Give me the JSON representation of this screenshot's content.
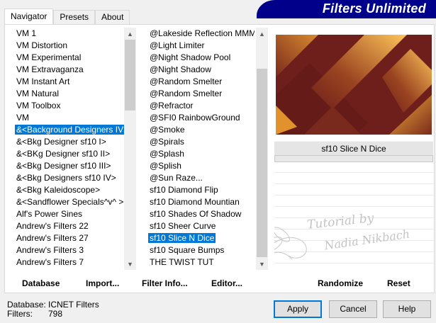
{
  "tabs": [
    {
      "label": "Navigator",
      "active": true
    },
    {
      "label": "Presets",
      "active": false
    },
    {
      "label": "About",
      "active": false
    }
  ],
  "banner": {
    "title": "Filters Unlimited",
    "color": "#00008b"
  },
  "categories": {
    "items": [
      "VM 1",
      "VM Distortion",
      "VM Experimental",
      "VM Extravaganza",
      "VM Instant Art",
      "VM Natural",
      "VM Toolbox",
      "VM",
      "&<Background Designers IV>",
      "&<Bkg Designer sf10 I>",
      "&<BKg Designer sf10 II>",
      "&<Bkg Designer sf10 III>",
      "&<Bkg Designers sf10 IV>",
      "&<Bkg Kaleidoscope>",
      "&<Sandflower Specials^v^ >",
      "Alf's Power Sines",
      "Andrew's Filters 22",
      "Andrew's Filters 27",
      "Andrew's Filters 3",
      "Andrew's Filters 7"
    ],
    "selected_index": 8
  },
  "filters": {
    "items": [
      "@Lakeside Reflection MMMM",
      "@Light Limiter",
      "@Night Shadow Pool",
      "@Night Shadow",
      "@Random Smelter",
      "@Random Smelter",
      "@Refractor",
      "@SFI0 RainbowGround",
      "@Smoke",
      "@Spirals",
      "@Splash",
      "@Splish",
      "@Sun Raze...",
      "sf10 Diamond Flip",
      "sf10 Diamond Mountian",
      "sf10 Shades Of Shadow",
      "sf10 Sheer Curve",
      "sf10 Slice N Dice",
      "sf10 Square Bumps",
      "THE TWIST TUT"
    ],
    "selected_index": 17
  },
  "preview": {
    "filter_name": "sf10 Slice N Dice",
    "colors": {
      "dark": "#6e1f1c",
      "light": "#f0a030"
    }
  },
  "watermark": {
    "line1": "Tutorial by",
    "line2": "Nadia Nikbach"
  },
  "toolbar": {
    "database": "Database",
    "import": "Import...",
    "filter_info": "Filter Info...",
    "editor": "Editor...",
    "randomize": "Randomize",
    "reset": "Reset"
  },
  "info": {
    "database_label": "Database:",
    "database_value": "ICNET Filters",
    "filters_label": "Filters:",
    "filters_value": "798"
  },
  "buttons": {
    "apply": "Apply",
    "cancel": "Cancel",
    "help": "Help"
  },
  "accent": "#0078d7"
}
